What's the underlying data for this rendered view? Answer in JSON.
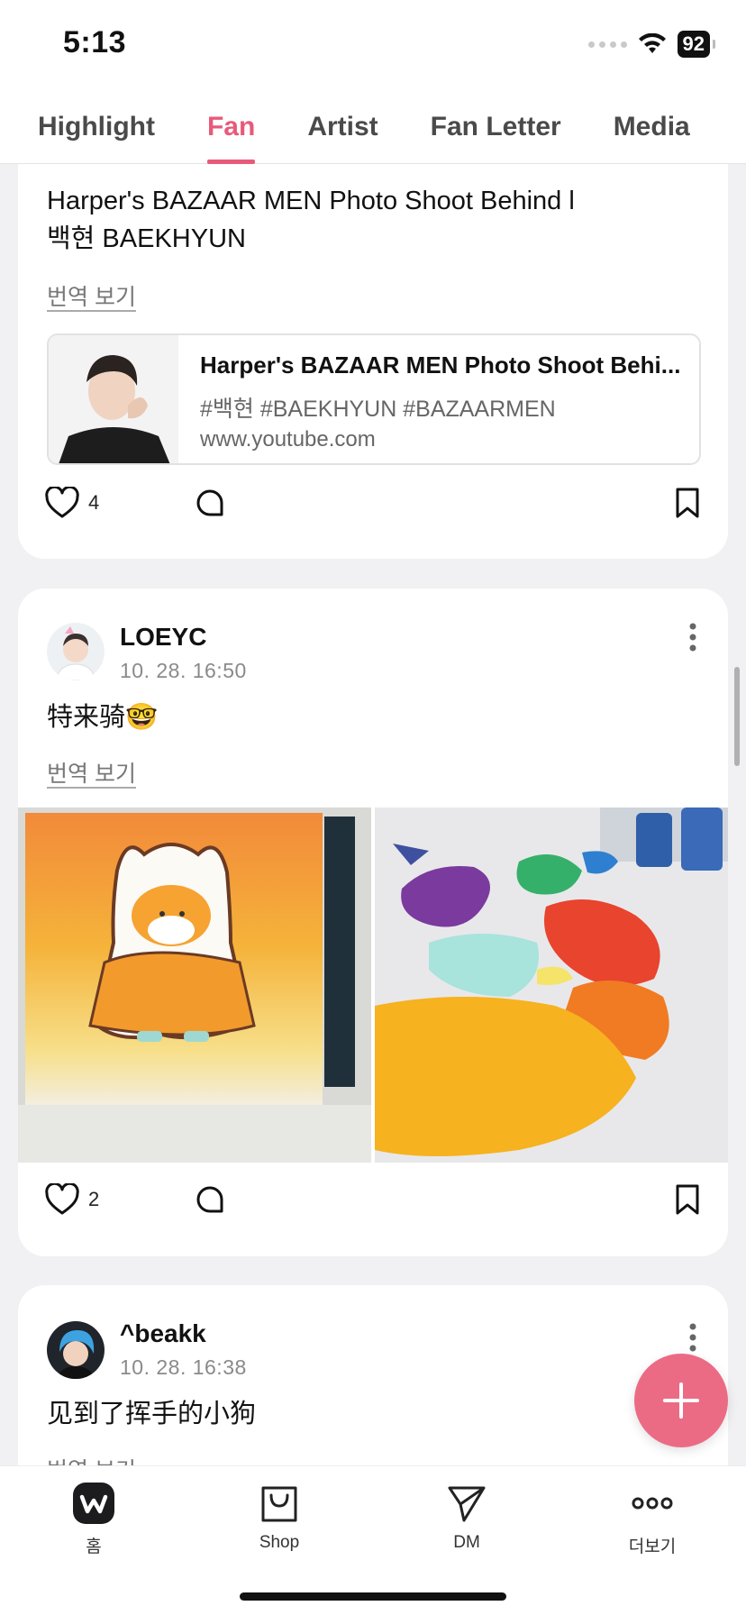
{
  "status": {
    "time": "5:13",
    "battery": "92"
  },
  "tabs": [
    {
      "label": "Highlight",
      "active": false
    },
    {
      "label": "Fan",
      "active": true
    },
    {
      "label": "Artist",
      "active": false
    },
    {
      "label": "Fan Letter",
      "active": false
    },
    {
      "label": "Media",
      "active": false
    }
  ],
  "accent_color": "#e85a7a",
  "posts": [
    {
      "title_line1": "Harper's BAZAAR MEN Photo Shoot Behind l",
      "title_line2": "백현 BAEKHYUN",
      "translate_label": "번역 보기",
      "link": {
        "title": "Harper's BAZAAR MEN Photo Shoot Behi...",
        "tags": "#백현 #BAEKHYUN #BAZAARMEN",
        "url": "www.youtube.com"
      },
      "like_count": "4"
    },
    {
      "author": "LOEYC",
      "time": "10. 28. 16:50",
      "text": "特来骑🤓",
      "translate_label": "번역 보기",
      "like_count": "2"
    },
    {
      "author": "^beakk",
      "time": "10. 28. 16:38",
      "text": "见到了挥手的小狗",
      "translate_label": "번역 보기"
    }
  ],
  "nav": [
    {
      "label": "홈",
      "icon": "weverse-home-icon"
    },
    {
      "label": "Shop",
      "icon": "shop-bag-icon"
    },
    {
      "label": "DM",
      "icon": "dm-send-icon"
    },
    {
      "label": "더보기",
      "icon": "more-dots-icon"
    }
  ]
}
